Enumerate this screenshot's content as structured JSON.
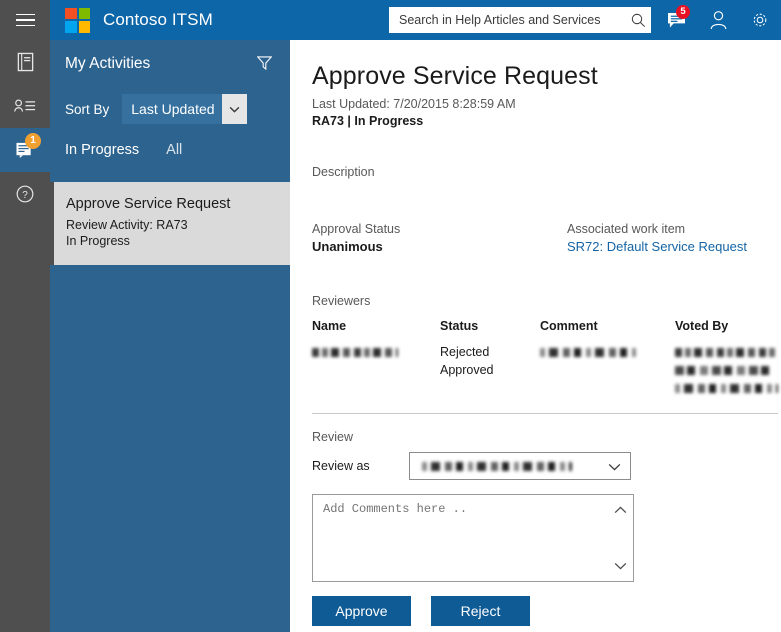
{
  "header": {
    "menu_icon": "hamburger-icon",
    "logo_icon": "microsoft-logo",
    "logo_colors": [
      "#f25022",
      "#7fba00",
      "#00a4ef",
      "#ffb900"
    ],
    "brand": "Contoso ITSM",
    "search": {
      "placeholder": "Search in Help Articles and Services",
      "value": "",
      "icon": "search-icon"
    },
    "icons": [
      {
        "name": "messages-icon",
        "badge": "5",
        "badge_color": "#e81123"
      },
      {
        "name": "user-account-icon",
        "badge": ""
      },
      {
        "name": "settings-gear-icon",
        "badge": ""
      }
    ],
    "bar_color": "#0c66a8"
  },
  "rail": {
    "items": [
      {
        "name": "knowledge-articles-icon",
        "badge": "",
        "active": false
      },
      {
        "name": "my-requests-icon",
        "badge": "",
        "active": false
      },
      {
        "name": "my-activities-icon",
        "badge": "1",
        "active": true
      },
      {
        "name": "help-icon",
        "badge": "",
        "active": false
      }
    ],
    "badge_color": "#f0a030",
    "active_color": "#2d638f",
    "bg_color": "#4f4f4f"
  },
  "left_panel": {
    "title": "My Activities",
    "filter_icon": "filter-funnel-icon",
    "sort_label": "Sort By",
    "sort_value": "Last Updated",
    "sort_chevron": "chevron-down-icon",
    "tabs": [
      {
        "label": "In Progress",
        "selected": true
      },
      {
        "label": "All",
        "selected": false
      }
    ],
    "list": [
      {
        "title": "Approve Service Request",
        "line1": "Review Activity: RA73",
        "line2": "In Progress",
        "selected": true
      }
    ],
    "bg_color": "#2d638f"
  },
  "main": {
    "title": "Approve Service Request",
    "last_updated": "Last Updated: 7/20/2015 8:28:59 AM",
    "id_line": "RA73  |  In Progress",
    "description_label": "Description",
    "description_value": "",
    "approval_status_label": "Approval Status",
    "approval_status_value": "Unanimous",
    "associated_work_item_label": "Associated work item",
    "associated_work_item_link": "SR72: Default Service Request",
    "link_color": "#1464a5",
    "reviewers_label": "Reviewers",
    "reviewers_table": {
      "columns": [
        "Name",
        "Status",
        "Comment",
        "Voted By"
      ],
      "rows": [
        {
          "name": "[redacted]",
          "status": "Rejected",
          "comment": "[redacted]",
          "voted_by": "[redacted]"
        },
        {
          "name": "",
          "status": "Approved",
          "comment": "",
          "voted_by": "[redacted]"
        },
        {
          "name": "",
          "status": "",
          "comment": "",
          "voted_by": "[redacted]"
        }
      ]
    },
    "review_label": "Review",
    "review_as_label": "Review as",
    "review_as_value": "[redacted]",
    "review_as_chevron": "chevron-down-icon",
    "comment_placeholder": "Add Comments here ..",
    "comment_value": "",
    "scroll_up_icon": "chevron-up-icon",
    "scroll_down_icon": "chevron-down-icon",
    "approve_button": "Approve",
    "reject_button": "Reject",
    "button_color": "#0f5b96"
  }
}
